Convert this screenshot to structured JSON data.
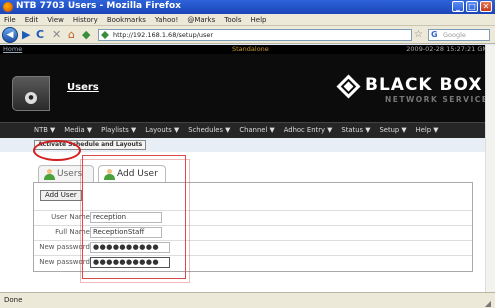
{
  "window": {
    "title": "NTB 7703 Users - Mozilla Firefox",
    "minimize": "_",
    "maximize": "□",
    "close": "✕"
  },
  "menubar": [
    "File",
    "Edit",
    "View",
    "History",
    "Bookmarks",
    "Yahoo!",
    "@Marks",
    "Tools",
    "Help"
  ],
  "toolbar": {
    "back": "◀",
    "forward": "▶",
    "reload": "C",
    "stop": "✕",
    "home": "⌂",
    "url": "http://192.168.1.68/setup/user",
    "star": "☆",
    "search_placeholder": "Google"
  },
  "page": {
    "home_link": "Home",
    "mode": "Standalone",
    "datetime": "2009-02-28 15:27:21 GMT",
    "page_title": "Users",
    "logo_brand": "BLACK BOX",
    "logo_sub": "NETWORK SERVICES",
    "nav": [
      "NTB ▼",
      "Media ▼",
      "Playlists ▼",
      "Layouts ▼",
      "Schedules ▼",
      "Channel ▼",
      "Adhoc Entry ▼",
      "Status ▼",
      "Setup ▼",
      "Help ▼"
    ],
    "activate_button": "Activate Schedule and Layouts",
    "tabs": [
      {
        "label": "Users",
        "active": false
      },
      {
        "label": "Add User",
        "active": true
      }
    ],
    "add_user_button": "Add User",
    "form": [
      {
        "label": "User Name",
        "value": "reception",
        "type": "text"
      },
      {
        "label": "Full Name",
        "value": "ReceptionStaff",
        "type": "text"
      },
      {
        "label": "New password",
        "value": "●●●●●●●●●●",
        "type": "password"
      },
      {
        "label": "New password",
        "value": "●●●●●●●●●●",
        "type": "password"
      }
    ]
  },
  "status": {
    "text": "Done"
  },
  "colors": {
    "titlebar": "#2f63d9",
    "banner": "#0c0c0c",
    "nav_bg": "#262626",
    "highlight": "#d21f1f"
  }
}
